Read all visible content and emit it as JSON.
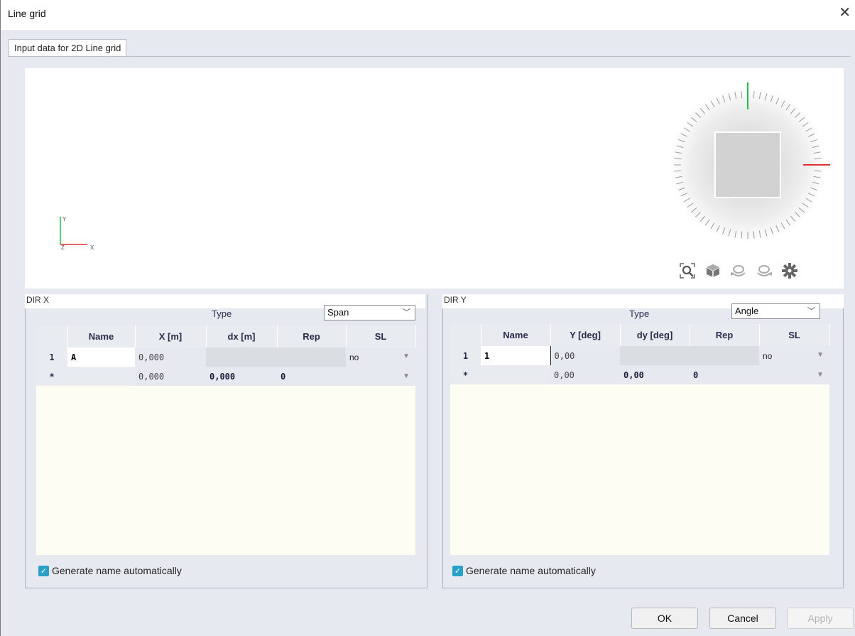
{
  "window": {
    "title": "Line grid",
    "close_icon": "close-icon"
  },
  "tab": {
    "label": "Input data for 2D Line grid"
  },
  "viewport": {
    "axis": {
      "y": "Y",
      "x": "X",
      "z": "Z"
    },
    "tools": [
      "zoom-all-icon",
      "view-3d-icon",
      "rotate-left-icon",
      "rotate-right-icon",
      "settings-icon"
    ]
  },
  "dir_x": {
    "header": "DIR X",
    "type_label": "Type",
    "type_value": "Span",
    "columns": [
      "Name",
      "X [m]",
      "dx [m]",
      "Rep",
      "SL"
    ],
    "rows": [
      {
        "num": "1",
        "name": "A",
        "value": "0,000",
        "delta": "",
        "rep": "",
        "sl": "no"
      },
      {
        "num": "*",
        "name": "",
        "value": "0,000",
        "delta": "0,000",
        "rep": "0",
        "sl": ""
      }
    ],
    "generate_label": "Generate name automatically"
  },
  "dir_y": {
    "header": "DIR Y",
    "type_label": "Type",
    "type_value": "Angle",
    "columns": [
      "Name",
      "Y [deg]",
      "dy [deg]",
      "Rep",
      "SL"
    ],
    "rows": [
      {
        "num": "1",
        "name": "1",
        "value": "0,00",
        "delta": "",
        "rep": "",
        "sl": "no"
      },
      {
        "num": "*",
        "name": "",
        "value": "0,00",
        "delta": "0,00",
        "rep": "0",
        "sl": ""
      }
    ],
    "generate_label": "Generate name automatically"
  },
  "buttons": {
    "ok": "OK",
    "cancel": "Cancel",
    "apply": "Apply"
  },
  "colors": {
    "checkbox": "#2aa0c8",
    "axis_x": "#e03030",
    "axis_y": "#22c040"
  }
}
